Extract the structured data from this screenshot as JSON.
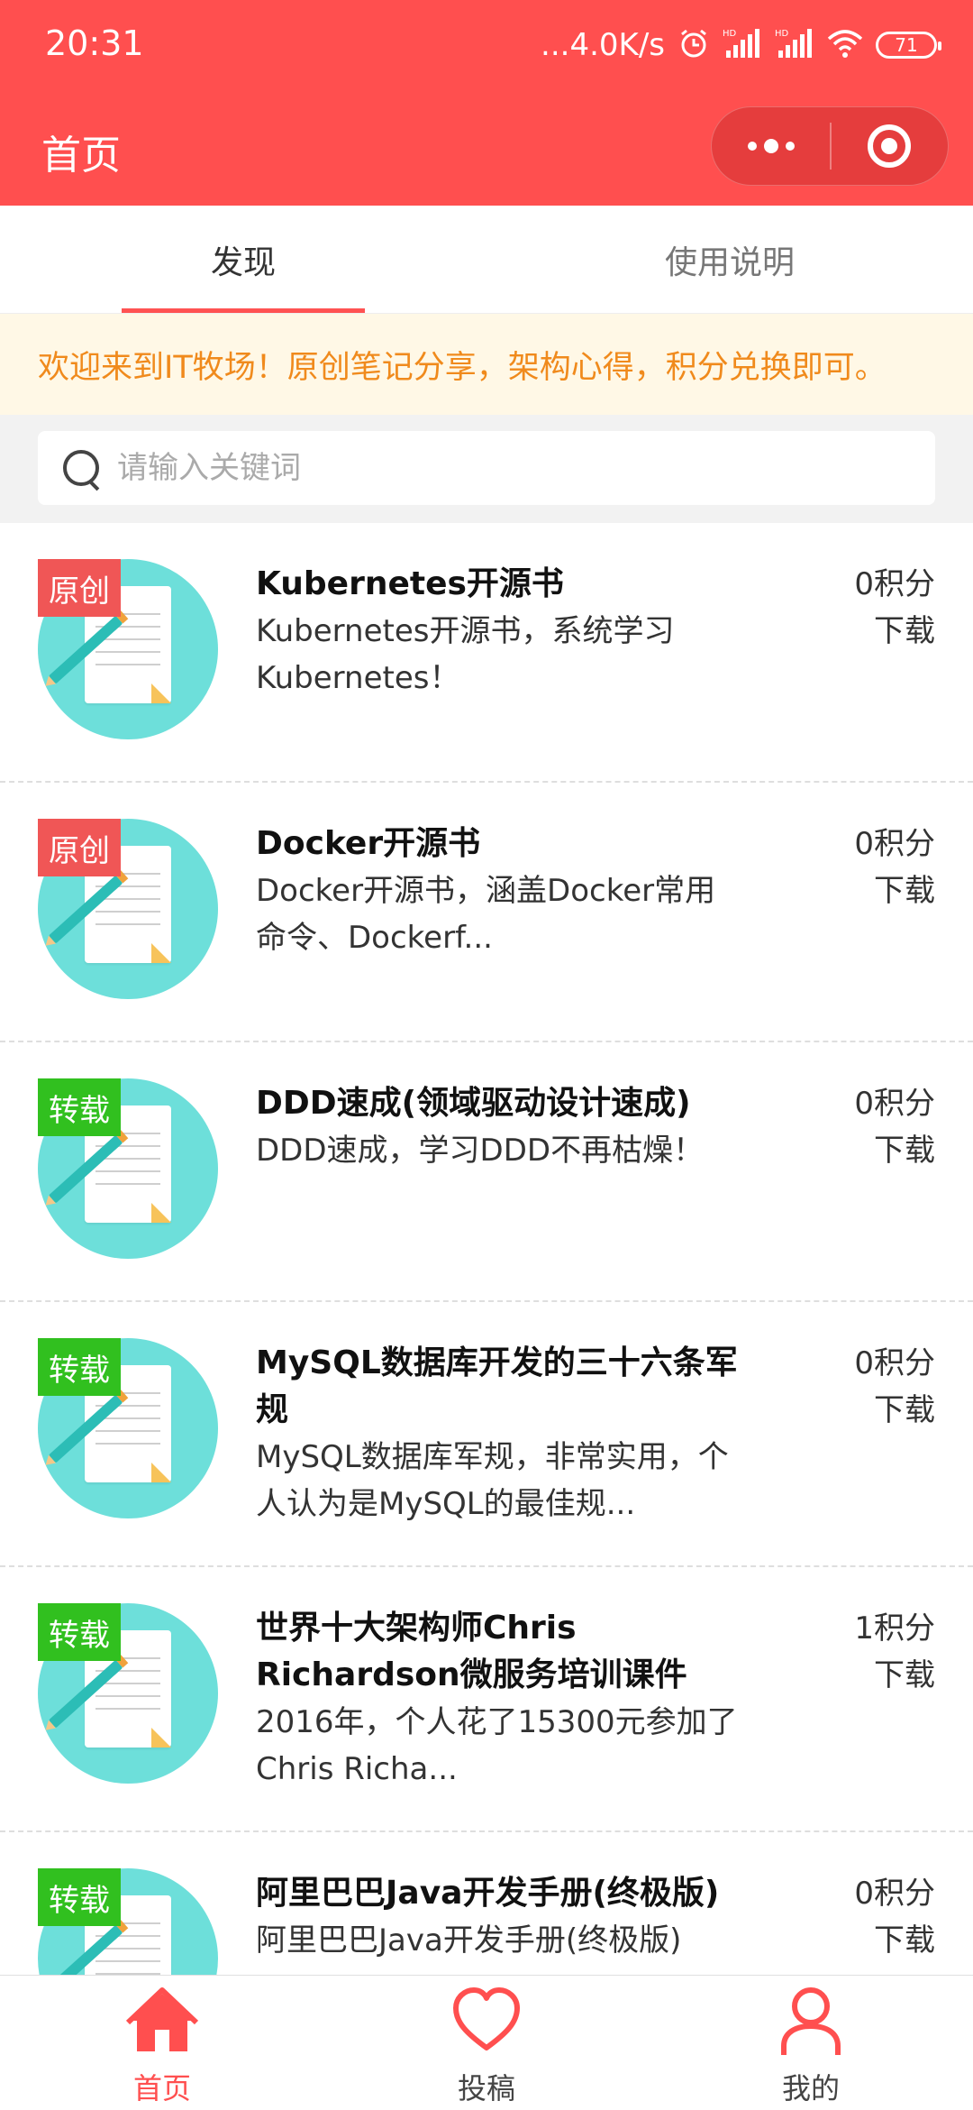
{
  "status_bar": {
    "time": "20:31",
    "speed": "...4.0K/s",
    "battery": "71",
    "icons": [
      "alarm-icon",
      "hd-signal-icon",
      "hd-signal-icon",
      "wifi-icon",
      "battery-icon"
    ]
  },
  "header": {
    "title": "首页",
    "capsule": {
      "more_icon": "more-dots-icon",
      "close_icon": "target-icon"
    }
  },
  "tabs": [
    {
      "label": "发现",
      "active": true
    },
    {
      "label": "使用说明",
      "active": false
    }
  ],
  "notice": "欢迎来到IT牧场！原创笔记分享，架构心得，积分兑换即可。",
  "search": {
    "placeholder": "请输入关键词",
    "value": ""
  },
  "items": [
    {
      "badge": "原创",
      "badge_color": "#f05656",
      "title": "Kubernetes开源书",
      "desc": "Kubernetes开源书，系统学习Kubernetes！",
      "points": "0积分",
      "action": "下载"
    },
    {
      "badge": "原创",
      "badge_color": "#f05656",
      "title": "Docker开源书",
      "desc": "Docker开源书，涵盖Docker常用命令、Dockerf...",
      "points": "0积分",
      "action": "下载"
    },
    {
      "badge": "转载",
      "badge_color": "#31c01f",
      "title": "DDD速成(领域驱动设计速成)",
      "desc": "DDD速成，学习DDD不再枯燥！",
      "points": "0积分",
      "action": "下载"
    },
    {
      "badge": "转载",
      "badge_color": "#31c01f",
      "title": "MySQL数据库开发的三十六条军规",
      "desc": "MySQL数据库军规，非常实用，个人认为是MySQL的最佳规...",
      "points": "0积分",
      "action": "下载"
    },
    {
      "badge": "转载",
      "badge_color": "#31c01f",
      "title": "世界十大架构师Chris Richardson微服务培训课件",
      "desc": "2016年，个人花了15300元参加了Chris Richa...",
      "points": "1积分",
      "action": "下载"
    },
    {
      "badge": "转载",
      "badge_color": "#31c01f",
      "title": "阿里巴巴Java开发手册(终极版)",
      "desc": "阿里巴巴Java开发手册(终极版)",
      "points": "0积分",
      "action": "下载"
    }
  ],
  "bottom_nav": [
    {
      "label": "首页",
      "icon": "home-icon",
      "active": true
    },
    {
      "label": "投稿",
      "icon": "heart-icon",
      "active": false
    },
    {
      "label": "我的",
      "icon": "user-icon",
      "active": false
    }
  ],
  "colors": {
    "primary": "#ff4f4f",
    "notice_text": "#f08a1c",
    "notice_bg": "#fff8e6",
    "original_badge": "#f05656",
    "repost_badge": "#31c01f",
    "thumb_circle": "#6ddfda"
  }
}
